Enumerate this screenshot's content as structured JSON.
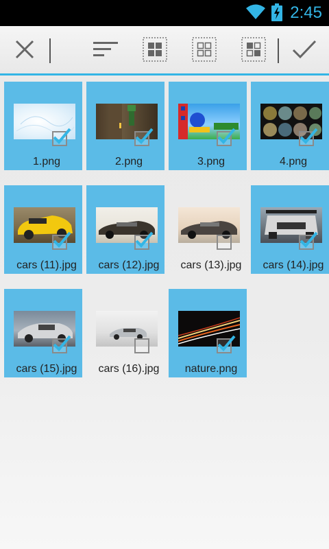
{
  "status_bar": {
    "time": "2:45",
    "icons": [
      "wifi-icon",
      "battery-charging-icon"
    ],
    "accent_color": "#33b5e5"
  },
  "toolbar": {
    "buttons": [
      "close-icon",
      "sort-icon",
      "select-all-icon",
      "select-none-icon",
      "invert-selection-icon",
      "confirm-check-icon"
    ]
  },
  "selection_color": "#5bbbe7",
  "files": [
    {
      "name": "1.png",
      "selected": true
    },
    {
      "name": "2.png",
      "selected": true
    },
    {
      "name": "3.png",
      "selected": true
    },
    {
      "name": "4.png",
      "selected": true
    },
    {
      "name": "cars (11).jpg",
      "selected": true
    },
    {
      "name": "cars (12).jpg",
      "selected": true
    },
    {
      "name": "cars (13).jpg",
      "selected": false
    },
    {
      "name": "cars (14).jpg",
      "selected": true
    },
    {
      "name": "cars (15).jpg",
      "selected": true
    },
    {
      "name": "cars (16).jpg",
      "selected": false
    },
    {
      "name": "nature.png",
      "selected": true
    }
  ]
}
